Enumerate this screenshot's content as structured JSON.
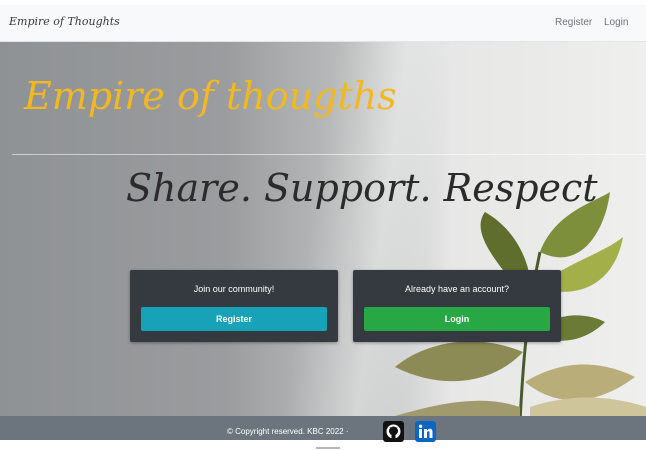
{
  "navbar": {
    "brand": "Empire of Thoughts",
    "links": [
      "Register",
      "Login"
    ]
  },
  "hero": {
    "title": "Empire of thougths",
    "tagline": "Share. Support. Respect."
  },
  "cards": [
    {
      "text": "Join our community!",
      "button": "Register",
      "button_color": "#17a2b8"
    },
    {
      "text": "Already have an account?",
      "button": "Login",
      "button_color": "#28a745"
    }
  ],
  "footer": {
    "copyright": "© Copyright reserved. KBC 2022 ·",
    "icons": [
      "github-icon",
      "linkedin-icon"
    ]
  },
  "colors": {
    "title_accent": "#f2b822",
    "card_bg": "#343a40",
    "footer_bg": "#6c757d"
  }
}
